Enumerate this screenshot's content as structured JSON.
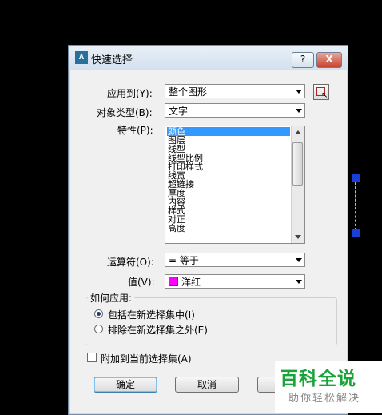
{
  "window": {
    "title": "快速选择",
    "icon_text": "A",
    "help_label": "?",
    "close_label": "X"
  },
  "form": {
    "apply_to_label": "应用到(Y):",
    "apply_to_value": "整个图形",
    "object_type_label": "对象类型(B):",
    "object_type_value": "文字",
    "properties_label": "特性(P):",
    "properties": [
      "颜色",
      "图层",
      "线型",
      "线型比例",
      "打印样式",
      "线宽",
      "超链接",
      "厚度",
      "内容",
      "样式",
      "对正",
      "高度"
    ],
    "selected_property": "颜色",
    "operator_label": "运算符(O):",
    "operator_value": "= 等于",
    "value_label": "值(V):",
    "value_value": "洋红",
    "value_color": "#ff00ff"
  },
  "how_to_apply": {
    "title": "如何应用:",
    "include_label": "包括在新选择集中(I)",
    "exclude_label": "排除在新选择集之外(E)",
    "selected": "include"
  },
  "append_label": "附加到当前选择集(A)",
  "append_checked": false,
  "buttons": {
    "ok": "确定",
    "cancel": "取消",
    "help": "帮"
  },
  "watermark": {
    "main": "百科全说",
    "sub": "助你轻松解决"
  }
}
